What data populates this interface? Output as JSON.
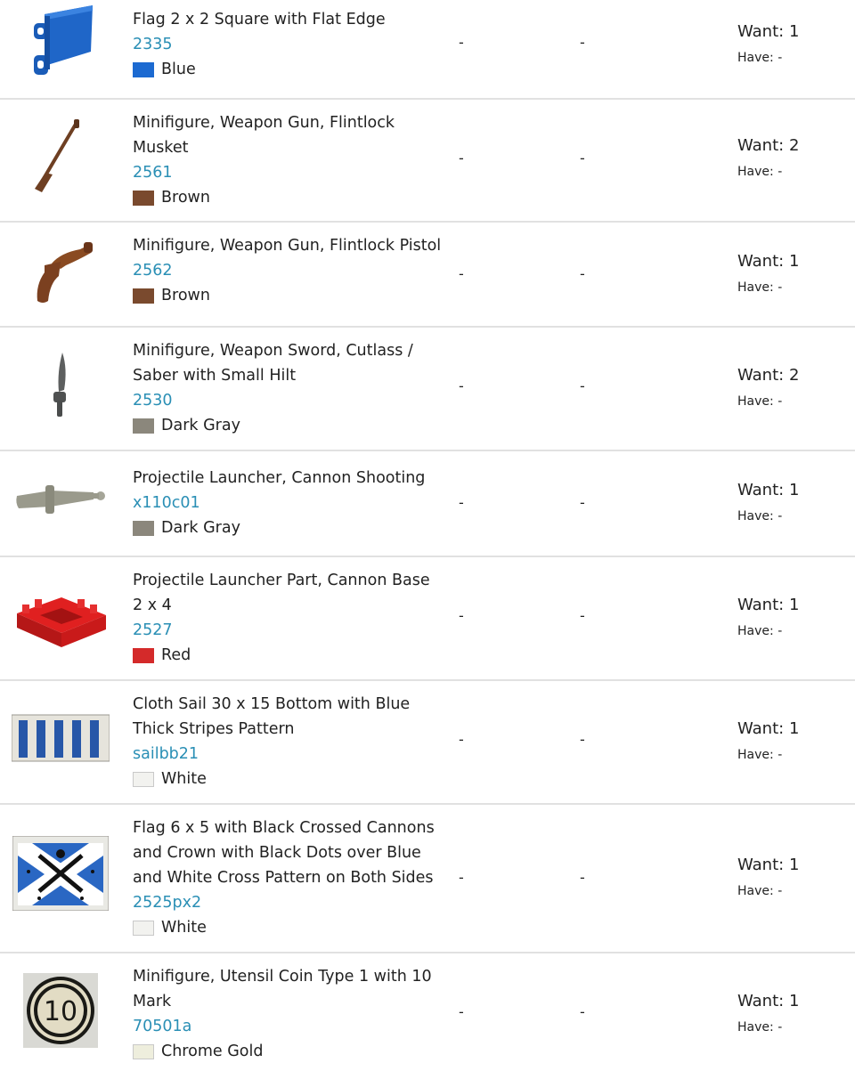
{
  "qty_labels": {
    "want": "Want:",
    "have": "Have:"
  },
  "items": [
    {
      "name": "Flag 2 x 2 Square with Flat Edge",
      "part": "2335",
      "color": "Blue",
      "color_hex": "#1c6ad1",
      "icon": "flag-blue-icon",
      "col1": "-",
      "col2": "-",
      "want": "1",
      "have": "-"
    },
    {
      "name": "Minifigure, Weapon Gun, Flintlock Musket",
      "part": "2561",
      "color": "Brown",
      "color_hex": "#7a4a2e",
      "icon": "musket-icon",
      "col1": "-",
      "col2": "-",
      "want": "2",
      "have": "-"
    },
    {
      "name": "Minifigure, Weapon Gun, Flintlock Pistol",
      "part": "2562",
      "color": "Brown",
      "color_hex": "#7a4a2e",
      "icon": "pistol-icon",
      "col1": "-",
      "col2": "-",
      "want": "1",
      "have": "-"
    },
    {
      "name": "Minifigure, Weapon Sword, Cutlass / Saber with Small Hilt",
      "part": "2530",
      "color": "Dark Gray",
      "color_hex": "#8b877c",
      "icon": "sword-icon",
      "col1": "-",
      "col2": "-",
      "want": "2",
      "have": "-"
    },
    {
      "name": "Projectile Launcher, Cannon Shooting",
      "part": "x110c01",
      "color": "Dark Gray",
      "color_hex": "#8b877c",
      "icon": "cannon-icon",
      "col1": "-",
      "col2": "-",
      "want": "1",
      "have": "-"
    },
    {
      "name": "Projectile Launcher Part, Cannon Base 2 x 4",
      "part": "2527",
      "color": "Red",
      "color_hex": "#d42a2a",
      "icon": "cannon-base-icon",
      "col1": "-",
      "col2": "-",
      "want": "1",
      "have": "-"
    },
    {
      "name": "Cloth Sail 30 x 15 Bottom with Blue Thick Stripes Pattern",
      "part": "sailbb21",
      "color": "White",
      "color_hex": "#f2f2ef",
      "icon": "sail-stripes-icon",
      "col1": "-",
      "col2": "-",
      "want": "1",
      "have": "-"
    },
    {
      "name": "Flag 6 x 5 with Black Crossed Cannons and Crown with Black Dots over Blue and White Cross Pattern on Both Sides",
      "part": "2525px2",
      "color": "White",
      "color_hex": "#f2f2ef",
      "icon": "flag-cross-icon",
      "col1": "-",
      "col2": "-",
      "want": "1",
      "have": "-"
    },
    {
      "name": "Minifigure, Utensil Coin Type 1 with 10 Mark",
      "part": "70501a",
      "color": "Chrome Gold",
      "color_hex": "#eeeedd",
      "icon": "coin-icon",
      "col1": "-",
      "col2": "-",
      "want": "1",
      "have": "-"
    }
  ]
}
